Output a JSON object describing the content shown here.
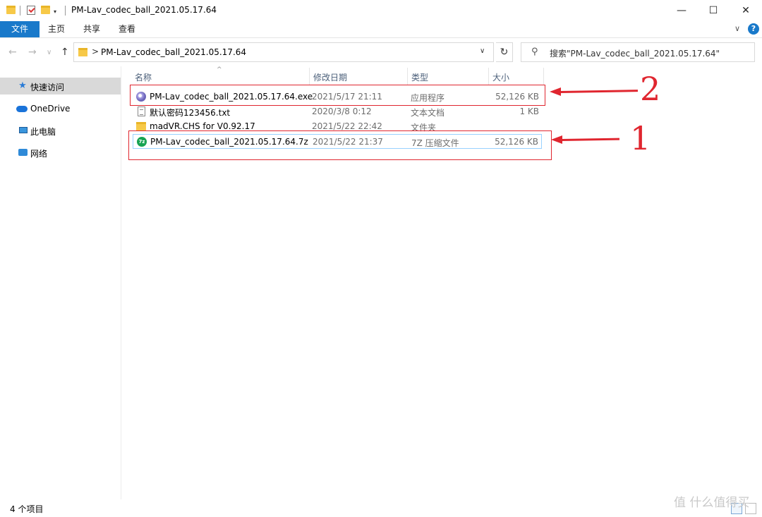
{
  "window": {
    "title": "PM-Lav_codec_ball_2021.05.17.64",
    "qa_dropdown": "▾",
    "minimize": "—",
    "maximize": "☐",
    "close": "✕"
  },
  "ribbon": {
    "tabs": [
      "文件",
      "主页",
      "共享",
      "查看"
    ],
    "expand_chevron": "∨",
    "help": "?"
  },
  "nav": {
    "back": "←",
    "forward": "→",
    "recent": "∨",
    "up": "↑",
    "breadcrumb_sep": ">",
    "address": "PM-Lav_codec_ball_2021.05.17.64",
    "address_chevron": "∨",
    "refresh": "↻",
    "search_placeholder": "搜索\"PM-Lav_codec_ball_2021.05.17.64\""
  },
  "sidebar": {
    "items": [
      {
        "label": "快速访问",
        "icon": "star-icon"
      },
      {
        "label": "OneDrive",
        "icon": "cloud-icon"
      },
      {
        "label": "此电脑",
        "icon": "computer-icon"
      },
      {
        "label": "网络",
        "icon": "network-icon"
      }
    ]
  },
  "list": {
    "sort_caret": "^",
    "headers": {
      "name": "名称",
      "date": "修改日期",
      "type": "类型",
      "size": "大小"
    },
    "rows": [
      {
        "name": "PM-Lav_codec_ball_2021.05.17.64.exe",
        "date": "2021/5/17 21:11",
        "type": "应用程序",
        "size": "52,126 KB",
        "icon": "exe-icon"
      },
      {
        "name": "默认密码123456.txt",
        "date": "2020/3/8 0:12",
        "type": "文本文档",
        "size": "1 KB",
        "icon": "text-file-icon"
      },
      {
        "name": "madVR.CHS for V0.92.17",
        "date": "2021/5/22 22:42",
        "type": "文件夹",
        "size": "",
        "icon": "folder-icon"
      },
      {
        "name": "PM-Lav_codec_ball_2021.05.17.64.7z",
        "date": "2021/5/22 21:37",
        "type": "7Z 压缩文件",
        "size": "52,126 KB",
        "icon": "7z-archive-icon"
      }
    ]
  },
  "annotations": {
    "label_2": "2",
    "label_1": "1",
    "color": "#e0262f"
  },
  "status": {
    "item_count": "4 个项目"
  },
  "watermark": "值 什么值得买",
  "colors": {
    "accent": "#1979ca",
    "selection": "#d9d9d9",
    "hover_border": "#99d1ff"
  }
}
